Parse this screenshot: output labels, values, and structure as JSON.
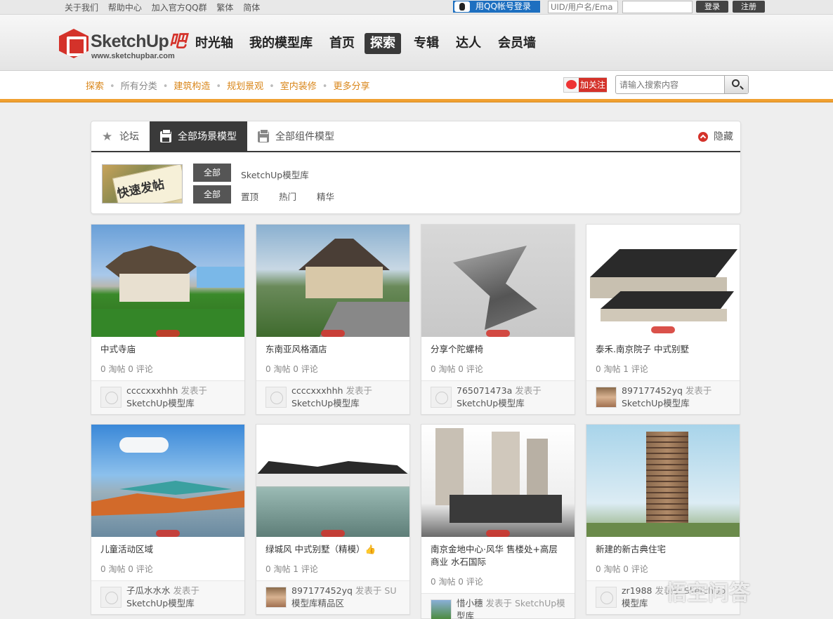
{
  "topbar": {
    "links": [
      "关于我们",
      "帮助中心",
      "加入官方QQ群",
      "繁体",
      "简体"
    ],
    "qq_login": "用QQ帐号登录",
    "uid_placeholder": "UID/用户名/Ema",
    "login": "登录",
    "register": "注册"
  },
  "header": {
    "logo_brand": "SketchUp",
    "logo_ba": "吧",
    "logo_url": "www.sketchupbar.com",
    "nav": [
      "时光轴",
      "我的模型库",
      "首页",
      "探索",
      "专辑",
      "达人",
      "会员墙"
    ],
    "nav_active": "探索"
  },
  "subnav": {
    "items": [
      "探索",
      "所有分类",
      "建筑构造",
      "规划景观",
      "室内装修",
      "更多分享"
    ],
    "follow": "加关注",
    "search_placeholder": "请输入搜索内容"
  },
  "panel": {
    "tabs": [
      "论坛",
      "全部场景模型",
      "全部组件模型"
    ],
    "active_tab": "全部场景模型",
    "hide": "隐藏",
    "quick_post": "快速发帖",
    "row1_pill": "全部",
    "row1_label": "SketchUp模型库",
    "row2_pill": "全部",
    "row2_filters": [
      "置顶",
      "热门",
      "精华"
    ]
  },
  "cards": [
    {
      "title": "中式寺庙",
      "stats": "0 淘帖  0 评论",
      "author": "ccccxxxhhh",
      "posted": "发表于",
      "forum": "SketchUp模型库"
    },
    {
      "title": "东南亚风格酒店",
      "stats": "0 淘帖  0 评论",
      "author": "ccccxxxhhh",
      "posted": "发表于",
      "forum": "SketchUp模型库"
    },
    {
      "title": "分享个陀螺椅",
      "stats": "0 淘帖  0 评论",
      "author": "765071473a",
      "posted": "发表于",
      "forum": "SketchUp模型库"
    },
    {
      "title": "泰禾.南京院子 中式别墅",
      "stats": "0 淘帖  1 评论",
      "author": "897177452yq",
      "posted": "发表于",
      "forum": "SketchUp模型库"
    },
    {
      "title": "儿童活动区域",
      "stats": "0 淘帖  0 评论",
      "author": "子瓜水水水",
      "posted": "发表于",
      "forum": "SketchUp模型库"
    },
    {
      "title": "绿城风 中式别墅（精模）👍",
      "stats": "0 淘帖  1 评论",
      "author": "897177452yq",
      "posted": "发表于 SU",
      "forum": "模型库精品区"
    },
    {
      "title": "南京金地中心·风华 售楼处+高层 商业 水石国际",
      "stats": "0 淘帖  0 评论",
      "author": "惜小穗",
      "posted": "发表于 SketchUp模",
      "forum": "型库"
    },
    {
      "title": "新建的新古典住宅",
      "stats": "0 淘帖  0 评论",
      "author": "zr1988",
      "posted": "发表于 SketchUp",
      "forum": "模型库"
    }
  ],
  "watermark": "悟空问答",
  "colors": {
    "accent": "#d9861a",
    "brand_red": "#d4322a",
    "dark": "#3a3a3a"
  }
}
